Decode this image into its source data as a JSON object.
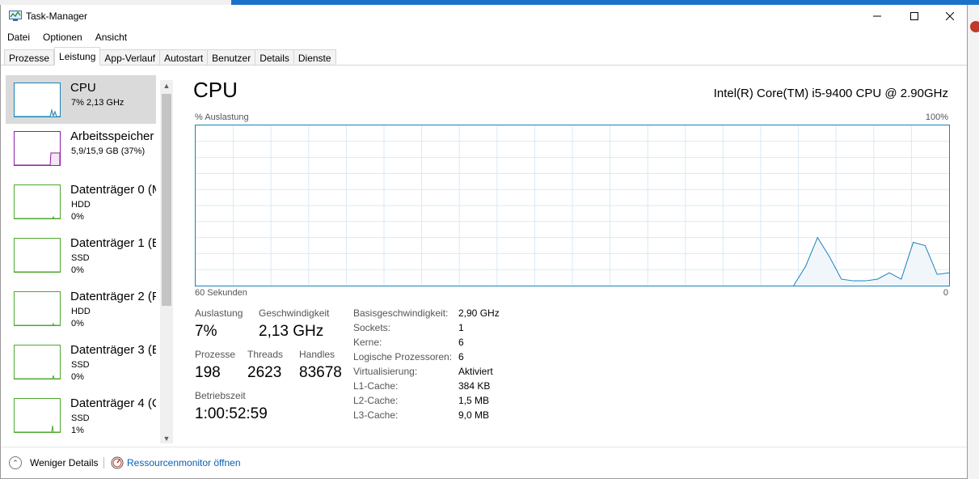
{
  "window": {
    "title": "Task-Manager"
  },
  "menu": [
    "Datei",
    "Optionen",
    "Ansicht"
  ],
  "tabs": [
    "Prozesse",
    "Leistung",
    "App-Verlauf",
    "Autostart",
    "Benutzer",
    "Details",
    "Dienste"
  ],
  "sidebar": {
    "items": [
      {
        "title": "CPU",
        "sub1": "7%  2,13 GHz",
        "sub2": "",
        "color": "#1a82b8"
      },
      {
        "title": "Arbeitsspeicher",
        "sub1": "5,9/15,9 GB (37%)",
        "sub2": "",
        "color": "#8b1ea1"
      },
      {
        "title": "Datenträger 0 (M",
        "sub1": "HDD",
        "sub2": "0%",
        "color": "#4ea72e"
      },
      {
        "title": "Datenträger 1 (E",
        "sub1": "SSD",
        "sub2": "0%",
        "color": "#4ea72e"
      },
      {
        "title": "Datenträger 2 (F",
        "sub1": "HDD",
        "sub2": "0%",
        "color": "#4ea72e"
      },
      {
        "title": "Datenträger 3 (E",
        "sub1": "SSD",
        "sub2": "0%",
        "color": "#4ea72e"
      },
      {
        "title": "Datenträger 4 (C",
        "sub1": "SSD",
        "sub2": "1%",
        "color": "#4ea72e"
      }
    ]
  },
  "main": {
    "title": "CPU",
    "model": "Intel(R) Core(TM) i5-9400 CPU @ 2.90GHz",
    "graph_label_top_left": "% Auslastung",
    "graph_label_top_right": "100%",
    "graph_label_bottom_left": "60 Sekunden",
    "graph_label_bottom_right": "0",
    "graph_color": "#1a82b8",
    "graph_values": [
      0,
      0,
      0,
      0,
      0,
      0,
      0,
      0,
      0,
      0,
      0,
      0,
      0,
      0,
      0,
      0,
      0,
      0,
      0,
      0,
      0,
      0,
      0,
      0,
      0,
      0,
      0,
      0,
      0,
      0,
      0,
      0,
      0,
      0,
      0,
      0,
      0,
      0,
      0,
      0,
      0,
      0,
      0,
      0,
      0,
      0,
      0,
      0,
      0,
      0,
      0,
      12,
      30,
      18,
      4,
      3,
      3,
      4,
      8,
      4,
      27,
      25,
      7,
      8
    ]
  },
  "stats": {
    "auslastung_label": "Auslastung",
    "auslastung_value": "7%",
    "geschwindigkeit_label": "Geschwindigkeit",
    "geschwindigkeit_value": "2,13 GHz",
    "prozesse_label": "Prozesse",
    "prozesse_value": "198",
    "threads_label": "Threads",
    "threads_value": "2623",
    "handles_label": "Handles",
    "handles_value": "83678",
    "betriebszeit_label": "Betriebszeit",
    "betriebszeit_value": "1:00:52:59"
  },
  "specs": [
    {
      "label": "Basisgeschwindigkeit:",
      "value": "2,90 GHz"
    },
    {
      "label": "Sockets:",
      "value": "1"
    },
    {
      "label": "Kerne:",
      "value": "6"
    },
    {
      "label": "Logische Prozessoren:",
      "value": "6"
    },
    {
      "label": "Virtualisierung:",
      "value": "Aktiviert"
    },
    {
      "label": "L1-Cache:",
      "value": "384 KB"
    },
    {
      "label": "L2-Cache:",
      "value": "1,5 MB"
    },
    {
      "label": "L3-Cache:",
      "value": "9,0 MB"
    }
  ],
  "footer": {
    "less_details": "Weniger Details",
    "resource_monitor": "Ressourcenmonitor öffnen"
  }
}
